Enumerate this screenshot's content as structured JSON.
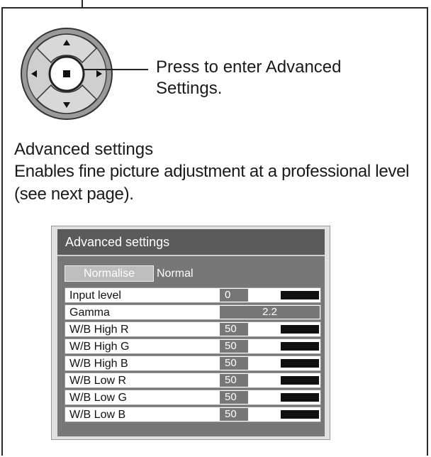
{
  "callout": {
    "line1": "Press to enter Advanced",
    "line2": "Settings."
  },
  "section": {
    "title": "Advanced settings",
    "description_line1": "Enables fine picture adjustment at a professional level",
    "description_line2": "(see next page)."
  },
  "osd": {
    "title": "Advanced settings",
    "normalise_label": "Normalise",
    "normalise_value": "Normal",
    "rows": [
      {
        "label": "Input level",
        "value": "0"
      },
      {
        "label": "Gamma",
        "value": "2.2"
      },
      {
        "label": "W/B High R",
        "value": "50"
      },
      {
        "label": "W/B High G",
        "value": "50"
      },
      {
        "label": "W/B High B",
        "value": "50"
      },
      {
        "label": "W/B Low R",
        "value": "50"
      },
      {
        "label": "W/B Low G",
        "value": "50"
      },
      {
        "label": "W/B Low B",
        "value": "50"
      }
    ]
  },
  "icons": [
    "up-arrow-icon",
    "down-arrow-icon",
    "left-arrow-icon",
    "right-arrow-icon",
    "enter-icon"
  ]
}
